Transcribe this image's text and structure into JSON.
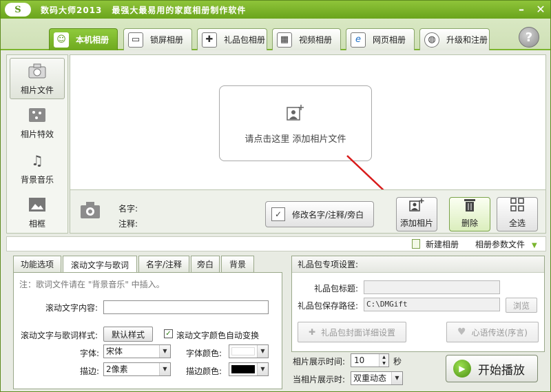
{
  "titlebar": {
    "logo": "S",
    "title": "数码大师2013",
    "slogan": "最强大最易用的家庭相册制作软件"
  },
  "tabs": [
    {
      "label": "本机相册",
      "icon": "person-photo-icon",
      "active": true
    },
    {
      "label": "锁屏相册",
      "icon": "monitor-icon"
    },
    {
      "label": "礼品包相册",
      "icon": "gift-icon"
    },
    {
      "label": "视频相册",
      "icon": "film-icon"
    },
    {
      "label": "网页相册",
      "icon": "ie-icon"
    },
    {
      "label": "升级和注册",
      "icon": "globe-icon"
    }
  ],
  "help": {
    "label": "?"
  },
  "sidebar": {
    "items": [
      {
        "label": "相片文件",
        "icon": "camera-icon",
        "active": true
      },
      {
        "label": "相片特效",
        "icon": "effects-icon"
      },
      {
        "label": "背景音乐",
        "icon": "music-note-icon"
      },
      {
        "label": "相框",
        "icon": "picture-frame-icon"
      }
    ]
  },
  "photoarea": {
    "add_prompt": "请点击这里  添加相片文件"
  },
  "info": {
    "name_label": "名字:",
    "note_label": "注释:",
    "edit_button": "修改名字/注释/旁白"
  },
  "actions": {
    "add": "添加相片",
    "delete": "删除",
    "select_all": "全选"
  },
  "menubar": {
    "new_album": "新建相册",
    "album_params": "相册参数文件"
  },
  "bottom_tabs": [
    {
      "label": "功能选项"
    },
    {
      "label": "滚动文字与歌词",
      "active": true
    },
    {
      "label": "名字/注释"
    },
    {
      "label": "旁白"
    },
    {
      "label": "背景"
    }
  ],
  "scroll_panel": {
    "note": "注：歌词文件请在 \"背景音乐\" 中插入。",
    "content_label": "滚动文字内容:",
    "content_value": "",
    "style_label": "滚动文字与歌词样式:",
    "default_style_button": "默认样式",
    "auto_color_label": "滚动文字颜色自动变换",
    "auto_color_checked": true,
    "font_label": "字体:",
    "font_value": "宋体",
    "font_color_label": "字体颜色:",
    "font_color": "#ffffff",
    "stroke_label": "描边:",
    "stroke_value": "2像素",
    "stroke_color_label": "描边颜色:",
    "stroke_color": "#000000"
  },
  "gift_panel": {
    "header": "礼品包专项设置:",
    "title_label": "礼品包标题:",
    "title_value": "",
    "path_label": "礼品包保存路径:",
    "path_value": "C:\\DMGift",
    "browse_button": "浏览",
    "cover_button": "礼品包封面详细设置",
    "message_button": "心语传送(序言)"
  },
  "playback": {
    "duration_label": "相片展示时间:",
    "duration_value": "10",
    "duration_unit": "秒",
    "transition_label": "当相片展示时:",
    "transition_value": "双重动态"
  },
  "start_button": "开始播放"
}
